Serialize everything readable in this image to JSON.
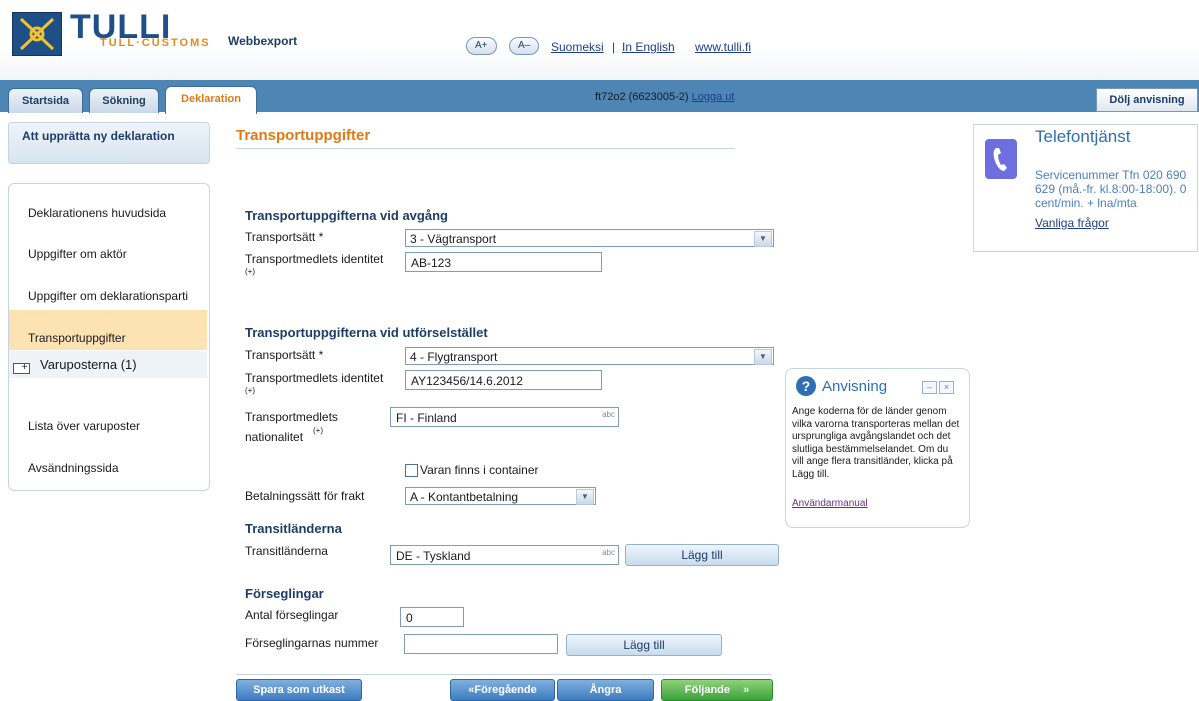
{
  "header": {
    "brand_main": "TULLI",
    "brand_sub": "TULL·CUSTOMS",
    "app_name": "Webbexport",
    "font_increase": "A+",
    "font_decrease": "A–",
    "lang_fi": "Suomeksi",
    "separator": "|",
    "lang_en": "In English",
    "site_link": "www.tulli.fi"
  },
  "nav": {
    "tabs": [
      {
        "label": "Startsida"
      },
      {
        "label": "Sökning"
      },
      {
        "label": "Deklaration"
      }
    ],
    "active_tab": "Deklaration",
    "user_id": "ft72o2 (6623005-2)",
    "logout": "Logga ut",
    "hide_help": "Dölj anvisning"
  },
  "sidebar": {
    "heading": "Att upprätta ny deklaration",
    "items": [
      {
        "label": "Deklarationens huvudsida"
      },
      {
        "label": "Uppgifter om aktör"
      },
      {
        "label": "Uppgifter om deklarationsparti"
      },
      {
        "label": "Transportuppgifter"
      },
      {
        "label": "Varuposterna (1)"
      },
      {
        "label": "Lista över varuposter"
      },
      {
        "label": "Avsändningssida"
      }
    ]
  },
  "main": {
    "title": "Transportuppgifter",
    "departure": {
      "heading": "Transportuppgifterna vid avgång",
      "mode_label": "Transportsätt *",
      "mode_value": "3 - Vägtransport",
      "identity_label": "Transportmedlets identitet",
      "identity_value": "AB-123"
    },
    "exit": {
      "heading": "Transportuppgifterna vid utförselstället",
      "mode_label": "Transportsätt *",
      "mode_value": "4 - Flygtransport",
      "identity_label": "Transportmedlets identitet",
      "identity_value": "AY123456/14.6.2012",
      "nationality_label_1": "Transportmedlets",
      "nationality_label_2": "nationalitet",
      "nationality_value": "FI - Finland"
    },
    "container_label": "Varan finns i container",
    "container_checked": false,
    "freight_label": "Betalningssätt för frakt",
    "freight_value": "A - Kontantbetalning",
    "transit": {
      "heading": "Transitländerna",
      "label": "Transitländerna",
      "value": "DE - Tyskland",
      "add": "Lägg till"
    },
    "seals": {
      "heading": "Förseglingar",
      "count_label": "Antal förseglingar",
      "count_value": "0",
      "number_label": "Förseglingarnas nummer",
      "number_value": "",
      "add": "Lägg till"
    },
    "spellcheck_tag": "abc",
    "info_mark": "(+)"
  },
  "footer": {
    "save_draft": "Spara som utkast",
    "previous": "«Föregående",
    "undo": "Ångra",
    "next": "Följande",
    "next_arrow": "»"
  },
  "phone_service": {
    "title": "Telefontjänst",
    "text": "Servicenummer Tfn 020 690 629 (må.-fr. kl.8:00-18:00). 0 cent/min. + lna/mta",
    "link": "Vanliga frågor"
  },
  "guidance": {
    "icon": "?",
    "title": "Anvisning",
    "text": "Ange koderna för de länder genom vilka varorna transporteras mellan det ursprungliga avgångslandet och det slutliga bestämmelselandet. Om du vill ange flera transitländer, klicka på Lägg till.",
    "link": "Användarmanual"
  },
  "colors": {
    "brand_blue": "#1e4f87",
    "nav_blue": "#4d86b4",
    "orange": "#e07a14",
    "green_button": "#3aa33a",
    "active_side": "#fde2b4"
  }
}
